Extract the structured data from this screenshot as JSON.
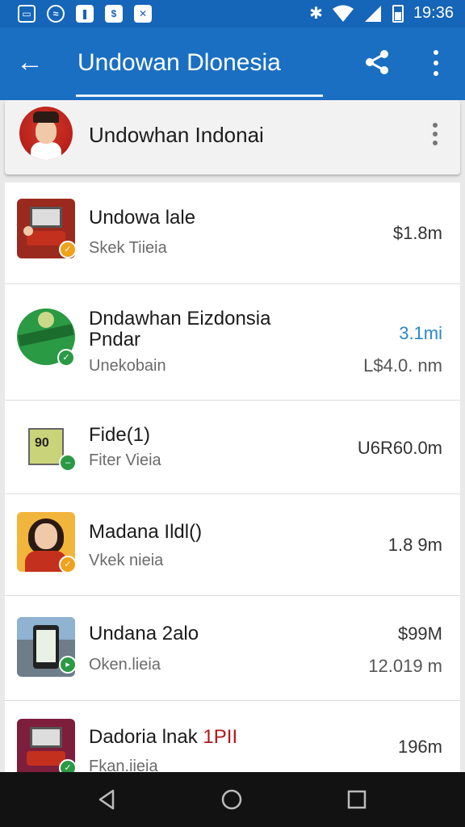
{
  "status_bar": {
    "time": "19:36",
    "left_icons": [
      "image-icon",
      "messenger-icon",
      "app-icon",
      "app-icon",
      "app-icon"
    ]
  },
  "app_bar": {
    "title": "Undowan Dlonesia",
    "back_icon": "arrow-back-icon",
    "share_icon": "share-icon",
    "more_icon": "more-vert-icon"
  },
  "account": {
    "name": "Undowhan Indonai"
  },
  "items": [
    {
      "title": "Undowa lale",
      "subtitle": "Skek Tiieia",
      "value": "$1.8m",
      "value2": ""
    },
    {
      "title": "Dndawhan Eizdonsia",
      "title2": "Pndar",
      "subtitle": "Unekobain",
      "value": "3.1mi",
      "value2": "L$4.0. nm"
    },
    {
      "title": "Fide(1)",
      "subtitle": "Fiter Vieia",
      "value": "U6R60.0m",
      "value2": ""
    },
    {
      "title": "Madana Ildl()",
      "subtitle": "Vkek nieia",
      "value": "1.8 9m",
      "value2": ""
    },
    {
      "title": "Undana 2alo",
      "subtitle": "Oken.lieia",
      "value": "$99M",
      "value2": "12.019  m"
    },
    {
      "title": "Dadoria lnak",
      "title_accent": "1PII",
      "subtitle": "Fkan.iieia",
      "value": "196m",
      "value2": ""
    }
  ],
  "colors": {
    "primary": "#1a6fc2",
    "status_bar": "#1565b8",
    "accent_blue": "#2a88c6",
    "badge_orange": "#f0a21c",
    "badge_green": "#2a9a44"
  }
}
